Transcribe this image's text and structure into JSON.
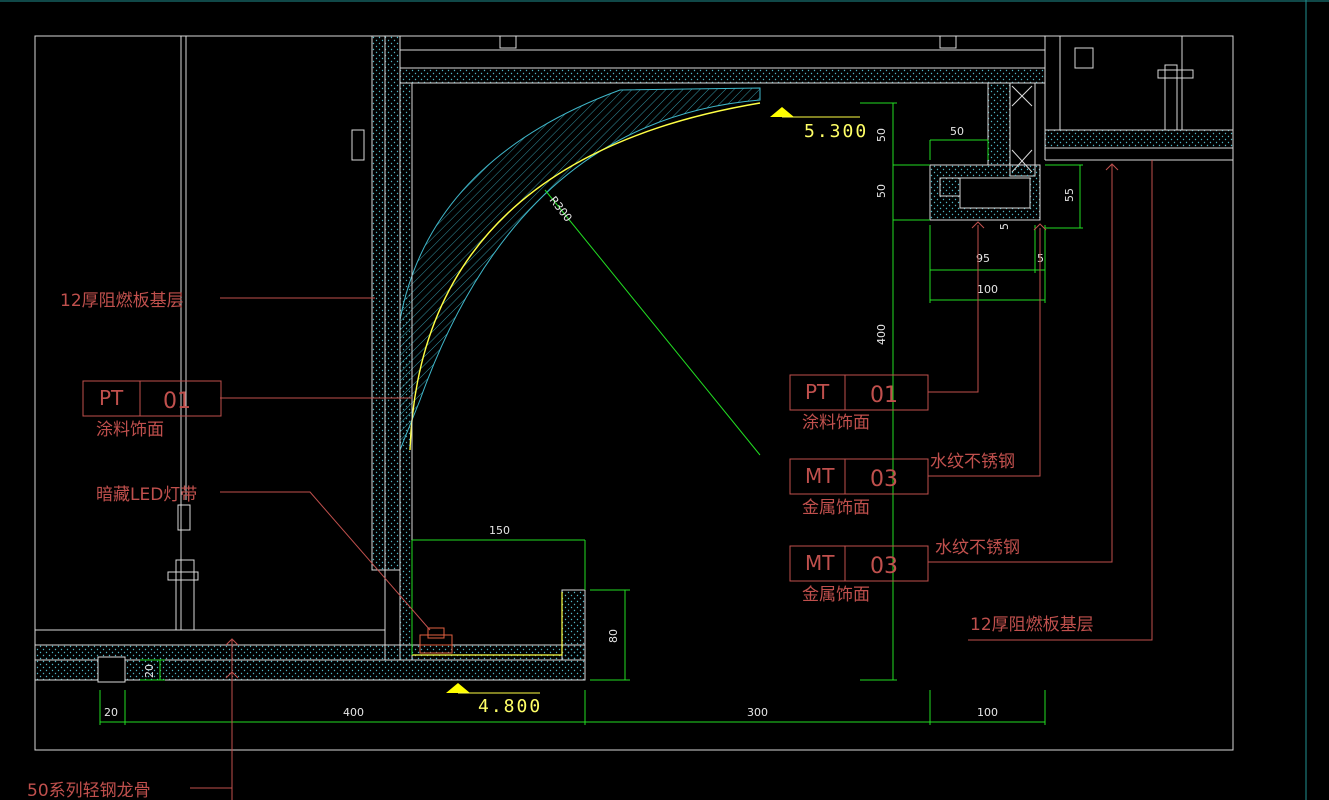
{
  "tags": [
    {
      "code": "PT",
      "num": "01",
      "desc": "涂料饰面",
      "note": ""
    },
    {
      "code": "PT",
      "num": "01",
      "desc": "涂料饰面",
      "note": ""
    },
    {
      "code": "MT",
      "num": "03",
      "desc": "金属饰面",
      "note": "水纹不锈钢"
    },
    {
      "code": "MT",
      "num": "03",
      "desc": "金属饰面",
      "note": "水纹不锈钢"
    }
  ],
  "labels": {
    "left_base_layer": "12厚阻燃板基层",
    "led_strip": "暗藏LED灯带",
    "right_base_layer": "12厚阻燃板基层",
    "keel": "50系列轻钢龙骨"
  },
  "elevations": {
    "top": "5.300",
    "bottom": "4.800"
  },
  "radius_label": "R300",
  "dimensions": {
    "d150": "150",
    "d80": "80",
    "d20a": "20",
    "d20b": "20",
    "d400_bottom": "400",
    "d300_bottom": "300",
    "d100_bottom": "100",
    "d50_top": "50",
    "d50_v1": "50",
    "d50_v2": "50",
    "d55": "55",
    "d5_v": "5",
    "d95": "95",
    "d5_h": "5",
    "d100_mid": "100",
    "d400_v": "400"
  },
  "colors": {
    "background": "#000000",
    "line_white": "#d9d9d9",
    "line_green": "#22dd22",
    "line_yellow": "#ffff44",
    "leader_red": "#c0504d",
    "hatch_cyan": "#3fb6c9",
    "border_teal": "#1f8f8f"
  }
}
